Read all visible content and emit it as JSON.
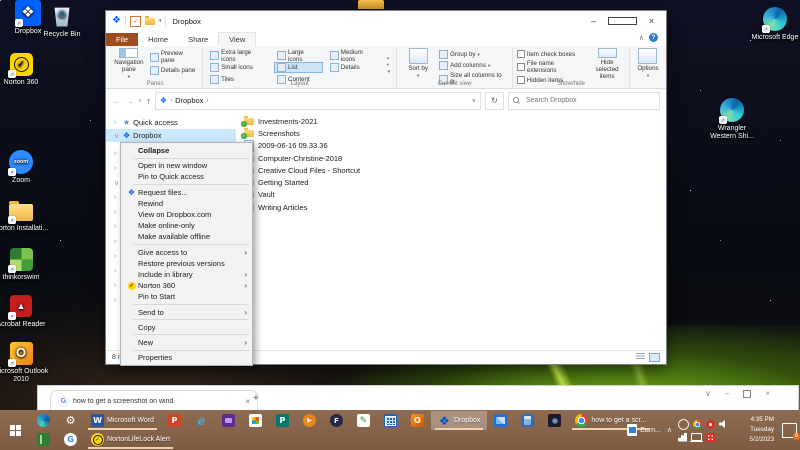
{
  "desktop": {
    "icons": [
      {
        "label": "Recycle Bin",
        "icon": "recyclebin",
        "badge": false
      },
      {
        "label": "Norton 360",
        "icon": "norton360",
        "badge": true
      },
      {
        "label": "Zoom",
        "icon": "zoomapp",
        "badge": true
      },
      {
        "label": "Norton Installati...",
        "icon": "folderbig",
        "badge": true
      },
      {
        "label": "thinkorswim",
        "icon": "thinkorswim",
        "badge": true
      },
      {
        "label": "Acrobat Reader",
        "icon": "acrobat",
        "badge": true
      },
      {
        "label": "Microsoft Outlook 2010",
        "icon": "outlook2010",
        "badge": true
      },
      {
        "label": "Microsoft Edge",
        "icon": "edgebig",
        "badge": true
      },
      {
        "label": "Wrangler Western Shi...",
        "icon": "edgebig",
        "badge": true
      },
      {
        "label": "Dropbox",
        "icon": "dropboxbig",
        "badge": true
      }
    ]
  },
  "explorer": {
    "title": "Dropbox",
    "tabs": [
      {
        "label": "File",
        "file": true
      },
      {
        "label": "Home"
      },
      {
        "label": "Share"
      },
      {
        "label": "View",
        "active": true
      }
    ],
    "ribbon": {
      "panes": {
        "group": "Panes",
        "navigation": "Navigation pane",
        "preview": "Preview pane",
        "details": "Details pane"
      },
      "layout": {
        "group": "Layout",
        "col1": [
          {
            "label": "Extra large icons"
          },
          {
            "label": "Small icons"
          },
          {
            "label": "Tiles"
          }
        ],
        "col2": [
          {
            "label": "Large icons"
          },
          {
            "label": "List",
            "selected": true
          },
          {
            "label": "Content"
          }
        ],
        "col3": [
          {
            "label": "Medium icons"
          },
          {
            "label": "Details"
          }
        ]
      },
      "current_view": {
        "group": "Current view",
        "sort_by": "Sort by",
        "items": [
          {
            "label": "Group by",
            "dd": true
          },
          {
            "label": "Add columns",
            "dd": true
          },
          {
            "label": "Size all columns to fit"
          }
        ]
      },
      "show_hide": {
        "group": "Show/hide",
        "checks": [
          "Item check boxes",
          "File name extensions",
          "Hidden items"
        ],
        "hide_selected": "Hide selected items"
      },
      "options": {
        "label": "Options"
      }
    },
    "address": {
      "path": "Dropbox",
      "search_placeholder": "Search Dropbox"
    },
    "nav": {
      "quick_access": "Quick access",
      "dropbox": "Dropbox",
      "tree_chevrons": [
        "›",
        "›",
        "∨",
        "›",
        "›",
        "›",
        "›",
        "›",
        "›",
        "›",
        "›"
      ]
    },
    "files": [
      {
        "label": "Investments-2021",
        "icon": "fold-sync"
      },
      {
        "label": "Screenshots",
        "icon": "fold-sync"
      },
      {
        "label": "2009-06-16 09.33.36",
        "icon": "filedoc"
      },
      {
        "label": "Computer-Christine-2018",
        "icon": "fold"
      },
      {
        "label": "Creative Cloud Files - Shortcut",
        "icon": "fold"
      },
      {
        "label": "Getting Started",
        "icon": "fold"
      },
      {
        "label": "Vault",
        "icon": "fold"
      },
      {
        "label": "Writing Articles",
        "icon": "fold"
      }
    ],
    "status": {
      "items_count": "8 items"
    }
  },
  "context_menu": {
    "items": [
      {
        "label": "Collapse",
        "bold": true
      },
      {
        "label": "Open in new window",
        "sep": true
      },
      {
        "label": "Pin to Quick access"
      },
      {
        "label": "Request files...",
        "sep": true,
        "icon": "menu-dropbox"
      },
      {
        "label": "Rewind"
      },
      {
        "label": "View on Dropbox.com"
      },
      {
        "label": "Make online-only"
      },
      {
        "label": "Make available offline"
      },
      {
        "label": "Give access to",
        "sep": true,
        "submenu": true
      },
      {
        "label": "Restore previous versions"
      },
      {
        "label": "Include in library",
        "submenu": true
      },
      {
        "label": "Norton 360",
        "submenu": true,
        "icon": "menu-norton"
      },
      {
        "label": "Pin to Start"
      },
      {
        "label": "Send to",
        "sep": true,
        "submenu": true
      },
      {
        "label": "Copy",
        "sep": true
      },
      {
        "label": "New",
        "sep": true,
        "submenu": true
      },
      {
        "label": "Properties",
        "sep": true
      }
    ]
  },
  "browser": {
    "tab_title": "how to get a screenshot on wind",
    "new_tab": "+"
  },
  "taskbar": {
    "row1": [
      {
        "icon": "edge"
      },
      {
        "icon": "settings"
      },
      {
        "icon": "word",
        "label": "Microsoft Word",
        "open": true
      },
      {
        "icon": "powerpoint"
      },
      {
        "icon": "ie"
      },
      {
        "icon": "app-purple"
      },
      {
        "icon": "store"
      },
      {
        "icon": "publisher"
      },
      {
        "icon": "media"
      },
      {
        "icon": "f-app"
      },
      {
        "icon": "notes"
      },
      {
        "icon": "calendar"
      },
      {
        "icon": "outlook"
      },
      {
        "icon": "dropbox",
        "label": "Dropbox",
        "open": true,
        "active": true
      },
      {
        "icon": "photos"
      },
      {
        "icon": "calculator"
      },
      {
        "icon": "app-dark"
      },
      {
        "icon": "chrome",
        "label": "how to get a scr...",
        "open": true
      }
    ],
    "row2": [
      {
        "icon": "book"
      },
      {
        "icon": "google"
      },
      {
        "icon": "norton",
        "label": "NortonLifeLock Alert",
        "open": true
      }
    ],
    "tray_icons_row1": [
      {
        "icon": "tray-clock"
      },
      {
        "icon": "chrome"
      },
      {
        "icon": "tray-red"
      },
      {
        "icon": "tray-speaker"
      }
    ],
    "tray_icons_row2": [
      {
        "icon": "tray-signal"
      },
      {
        "icon": "tray-laptop"
      },
      {
        "icon": "tray-grid"
      }
    ],
    "tray": {
      "overflow_label": "Earn...",
      "clock": {
        "time": "4:35 PM",
        "day": "Tuesday",
        "date": "5/2/2023"
      },
      "notification_badge": "8"
    }
  }
}
